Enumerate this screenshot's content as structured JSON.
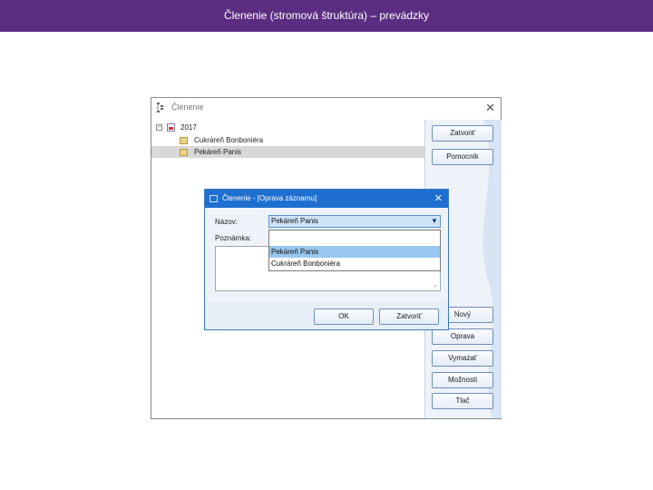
{
  "header": {
    "title": "Členenie (stromová štruktúra) – prevádzky"
  },
  "main_window": {
    "title": "Členenie",
    "close_glyph": "✕",
    "tree": {
      "root_label": "2017",
      "expander": "−",
      "items": [
        {
          "label": "Cukráreň Bonboniéra",
          "selected": false
        },
        {
          "label": "Pekáreň Panis",
          "selected": true
        }
      ]
    },
    "buttons": {
      "zatvorit": "Zatvoriť",
      "pomocnik": "Pomocník",
      "novy": "Nový",
      "oprava": "Oprava",
      "vymazat": "Vymazať",
      "moznosti": "Možnosti",
      "tlac": "Tlač"
    }
  },
  "dialog": {
    "title": "Členenie - [Oprava záznamu]",
    "close_glyph": "✕",
    "name_label": "Názov:",
    "name_value": "Pekáreň Panis",
    "note_label": "Poznámka:",
    "dropdown_options": [
      "",
      "Pekáreň Panis",
      "Cukráreň Bonboniéra"
    ],
    "dropdown_highlighted": "Pekáreň Panis",
    "ok_label": "OK",
    "close_label": "Zatvoriť"
  },
  "colors": {
    "header_bg": "#5a2d82",
    "dialog_title_bg": "#1e6fd0",
    "highlight": "#98c8f0"
  }
}
